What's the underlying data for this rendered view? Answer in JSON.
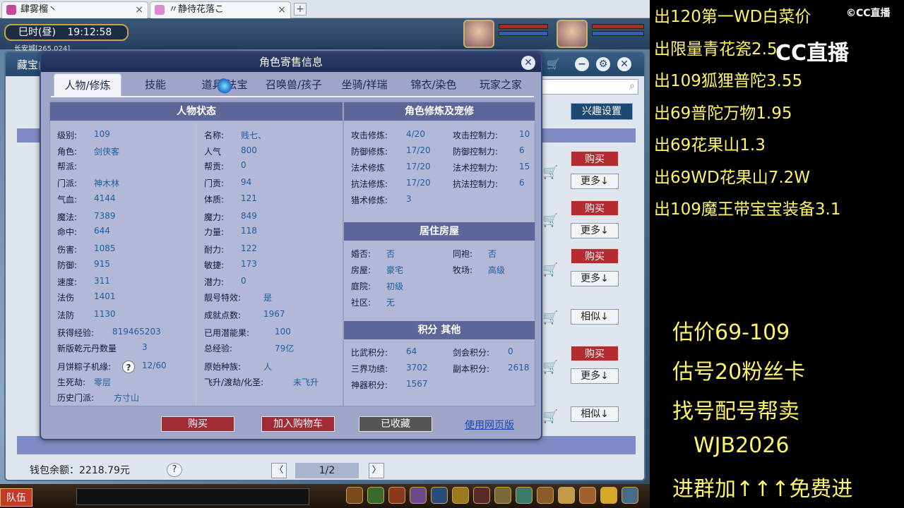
{
  "browser": {
    "tabs": [
      {
        "title": "肆雾榴丶"
      },
      {
        "title": "〃静待花落こ"
      }
    ],
    "new_tab": "+",
    "close": "×"
  },
  "hud": {
    "time_of_day": "巳时(昼)",
    "clock": "19:12:58",
    "location": "长安城[265,024]",
    "team_button": "队伍"
  },
  "trade_window": {
    "title": "藏宝阁",
    "interest_button": "兴趣设置",
    "buy_label": "购买",
    "more_label": "更多↓",
    "similar_label": "相似↓",
    "wallet": "钱包余额：2218.79元",
    "help": "?",
    "page": "1/2",
    "prev": "〈",
    "next": "〉",
    "minimize": "−",
    "settings": "⚙",
    "close": "✕"
  },
  "modal": {
    "title": "角色寄售信息",
    "close": "✕",
    "tabs": [
      {
        "label": "人物/修炼",
        "active": true
      },
      {
        "label": "技能"
      },
      {
        "label": "道具/法宝"
      },
      {
        "label": "召唤兽/孩子"
      },
      {
        "label": "坐骑/祥瑞"
      },
      {
        "label": "锦衣/染色"
      },
      {
        "label": "玩家之家"
      }
    ],
    "status": {
      "title": "人物状态",
      "left": [
        {
          "label": "级别:",
          "value": "109"
        },
        {
          "label": "角色:",
          "value": "剑侠客"
        },
        {
          "label": "帮派:",
          "value": ""
        },
        {
          "label": "门派:",
          "value": "神木林"
        },
        {
          "label": "气血:",
          "value": "4144"
        },
        {
          "label": "魔法:",
          "value": "7389"
        },
        {
          "label": "命中:",
          "value": "644"
        },
        {
          "label": "伤害:",
          "value": "1085"
        },
        {
          "label": "防御:",
          "value": "915"
        },
        {
          "label": "速度:",
          "value": "311"
        },
        {
          "label": "法伤",
          "value": "1401"
        },
        {
          "label": "法防",
          "value": "1130"
        },
        {
          "label": "获得经验:",
          "value": "819465203"
        },
        {
          "label": "新版乾元丹数量",
          "value": "3"
        },
        {
          "label": "月饼粽子机缘:",
          "value": "12/60"
        },
        {
          "label": "生死劫:",
          "value": "零层"
        },
        {
          "label": "历史门派:",
          "value": "方寸山"
        }
      ],
      "right": [
        {
          "label": "名称:",
          "value": "贱七、"
        },
        {
          "label": "人气",
          "value": "800"
        },
        {
          "label": "帮贡:",
          "value": "0"
        },
        {
          "label": "门贡:",
          "value": "94"
        },
        {
          "label": "体质:",
          "value": "121"
        },
        {
          "label": "魔力:",
          "value": "849"
        },
        {
          "label": "力量:",
          "value": "118"
        },
        {
          "label": "耐力:",
          "value": "122"
        },
        {
          "label": "敏捷:",
          "value": "173"
        },
        {
          "label": "潜力:",
          "value": "0"
        },
        {
          "label": "靓号特效:",
          "value": "是"
        },
        {
          "label": "成就点数:",
          "value": "1967"
        },
        {
          "label": "已用潜能果:",
          "value": "100"
        },
        {
          "label": "总经验:",
          "value": "79亿"
        },
        {
          "label": "原始种族:",
          "value": "人"
        },
        {
          "label": "飞升/渡劫/化圣:",
          "value": "未飞升"
        }
      ],
      "help_icon": "?"
    },
    "cultivation": {
      "title": "角色修炼及宠修",
      "left": [
        {
          "label": "攻击修炼:",
          "value": "4/20"
        },
        {
          "label": "防御修炼:",
          "value": "17/20"
        },
        {
          "label": "法术修炼",
          "value": "17/20"
        },
        {
          "label": "抗法修炼:",
          "value": "17/20"
        },
        {
          "label": "猎术修炼:",
          "value": "3"
        }
      ],
      "right": [
        {
          "label": "攻击控制力:",
          "value": "10"
        },
        {
          "label": "防御控制力:",
          "value": "6"
        },
        {
          "label": "法术控制力:",
          "value": "15"
        },
        {
          "label": "抗法控制力:",
          "value": "6"
        }
      ]
    },
    "house": {
      "title": "居住房屋",
      "left": [
        {
          "label": "婚否:",
          "value": "否"
        },
        {
          "label": "房屋:",
          "value": "豪宅"
        },
        {
          "label": "庭院:",
          "value": "初级"
        },
        {
          "label": "社区:",
          "value": "无"
        }
      ],
      "right": [
        {
          "label": "同袍:",
          "value": "否"
        },
        {
          "label": "牧场:",
          "value": "高级"
        }
      ]
    },
    "points": {
      "title": "积分 其他",
      "left": [
        {
          "label": "比武积分:",
          "value": "64"
        },
        {
          "label": "三界功绩:",
          "value": "3702"
        },
        {
          "label": "神器积分:",
          "value": "1567"
        }
      ],
      "right": [
        {
          "label": "剑会积分:",
          "value": "0"
        },
        {
          "label": "副本积分:",
          "value": "2618"
        }
      ]
    },
    "buttons": {
      "buy": "购买",
      "add_cart": "加入购物车",
      "favorited": "已收藏",
      "web": "使用网页版"
    }
  },
  "stream": {
    "logo_small": "©CC直播",
    "logo_big": "CC直播",
    "sales": [
      "出120第一WD白菜价",
      "出限量青花瓷2.5",
      "出109狐狸普陀3.55",
      "出69普陀万物1.95",
      "出69花果山1.3",
      "出69WD花果山7.2W",
      "出109魔王带宝宝装备3.1"
    ],
    "info": [
      "估价69-109",
      "估号20粉丝卡",
      "找号配号帮卖",
      "WJB2026",
      "进群加↑↑↑免费进"
    ]
  }
}
